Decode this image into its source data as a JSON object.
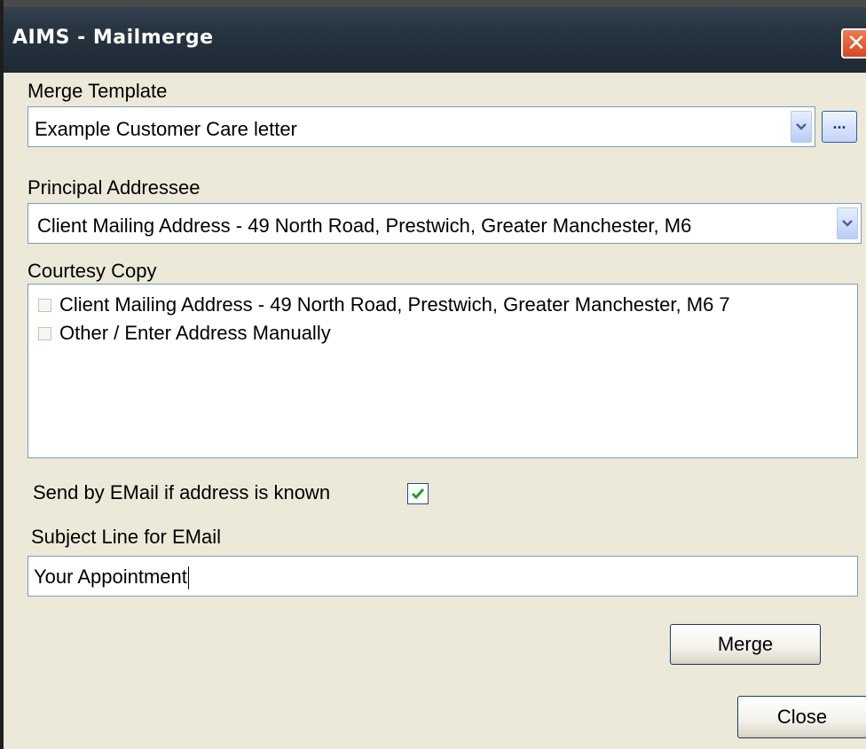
{
  "window": {
    "title": "AIMS - Mailmerge",
    "close_glyph": "✕",
    "icons": {
      "close": "close-icon"
    },
    "colors": {
      "titlebar": "#283642",
      "close_button": "#e05a2e",
      "background": "#ece9d8",
      "check_mark": "#21a121"
    }
  },
  "merge_template": {
    "label": "Merge Template",
    "value": "Example Customer Care letter",
    "browse_label": "..."
  },
  "principal_addressee": {
    "label": "Principal Addressee",
    "value": "Client Mailing Address - 49 North Road, Prestwich, Greater Manchester, M6"
  },
  "courtesy_copy": {
    "label": "Courtesy Copy",
    "items": [
      {
        "label": "Client Mailing Address - 49 North Road, Prestwich, Greater Manchester, M6 7",
        "checked": false
      },
      {
        "label": "Other / Enter Address Manually",
        "checked": false
      }
    ]
  },
  "email": {
    "send_label": "Send by EMail if address is known",
    "send_checked": true,
    "subject_label": "Subject Line for EMail",
    "subject_value": "Your Appointment"
  },
  "buttons": {
    "merge": "Merge",
    "close": "Close"
  }
}
